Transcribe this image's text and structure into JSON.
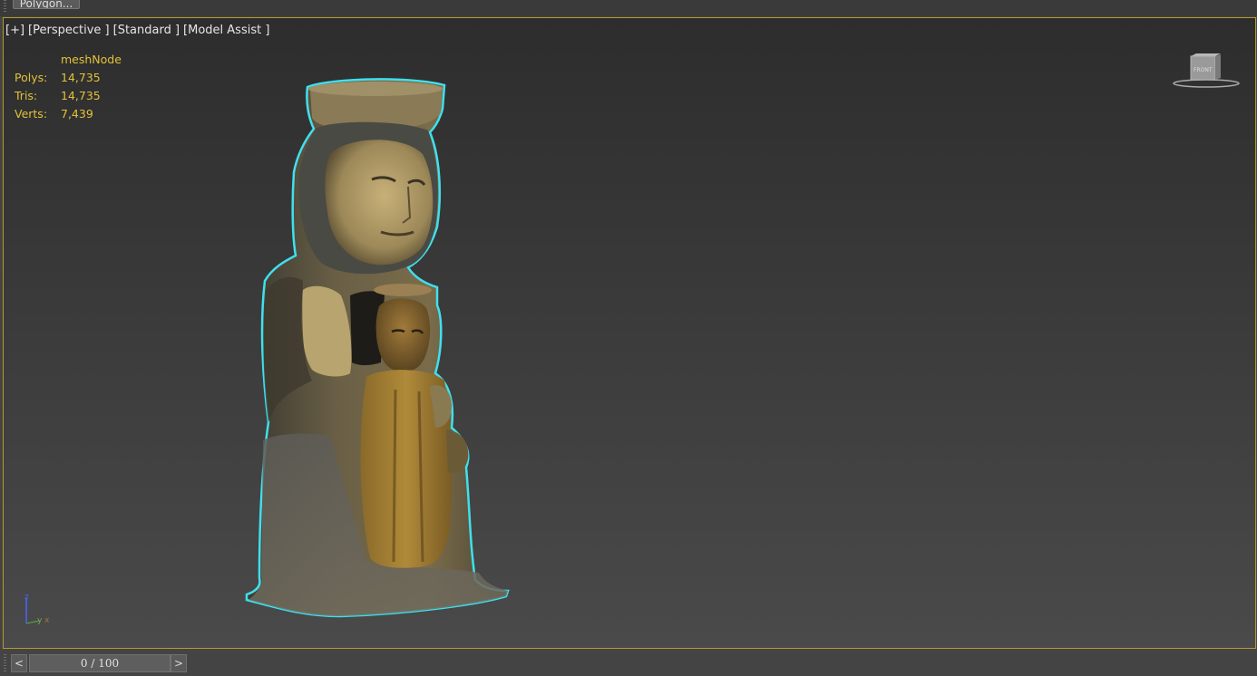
{
  "top_tab": {
    "label": "Polygon..."
  },
  "viewport": {
    "labels": [
      "[+]",
      "[Perspective ]",
      "[Standard ]",
      "[Model Assist ]"
    ],
    "border_color": "#b8982e",
    "stats": {
      "object_name": "meshNode",
      "rows": [
        {
          "key": "Polys:",
          "value": "14,735"
        },
        {
          "key": "Tris:",
          "value": "14,735"
        },
        {
          "key": "Verts:",
          "value": "7,439"
        }
      ],
      "color": "#e3c23a"
    },
    "viewcube": {
      "face_label": "FRONT"
    },
    "axis": {
      "z": "z",
      "y": "y",
      "x": "x"
    },
    "selection_outline_color": "#3fe0ee"
  },
  "timeline": {
    "prev_label": "<",
    "next_label": ">",
    "frame_text": "0 / 100"
  }
}
